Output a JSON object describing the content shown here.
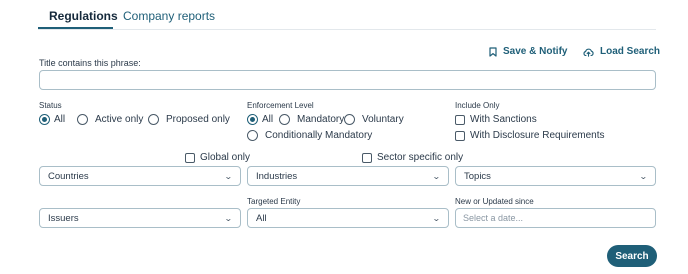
{
  "tabs": [
    {
      "label": "Regulations",
      "active": true
    },
    {
      "label": "Company reports",
      "active": false
    }
  ],
  "actions": {
    "save_notify": "Save & Notify",
    "load_search": "Load Search"
  },
  "title_field": {
    "label": "Title contains this phrase:",
    "value": "",
    "placeholder": ""
  },
  "status": {
    "label": "Status",
    "options": [
      "All",
      "Active only",
      "Proposed only"
    ],
    "selected": "All"
  },
  "enforcement": {
    "label": "Enforcement Level",
    "options": [
      "All",
      "Mandatory",
      "Voluntary",
      "Conditionally Mandatory"
    ],
    "selected": "All"
  },
  "include_only": {
    "label": "Include Only",
    "options": [
      "With Sanctions",
      "With Disclosure Requirements"
    ]
  },
  "global_only": "Global only",
  "sector_specific_only": "Sector specific only",
  "countries_select": "Countries",
  "industries_select": "Industries",
  "topics_select": "Topics",
  "issuers_select": "Issuers",
  "targeted_entity": {
    "label": "Targeted Entity",
    "value": "All"
  },
  "updated_since": {
    "label": "New or Updated since",
    "placeholder": "Select a date..."
  },
  "search_button": "Search",
  "colors": {
    "accent": "#1f5f78",
    "border": "#a9bec8",
    "text": "#2b3a4a"
  }
}
